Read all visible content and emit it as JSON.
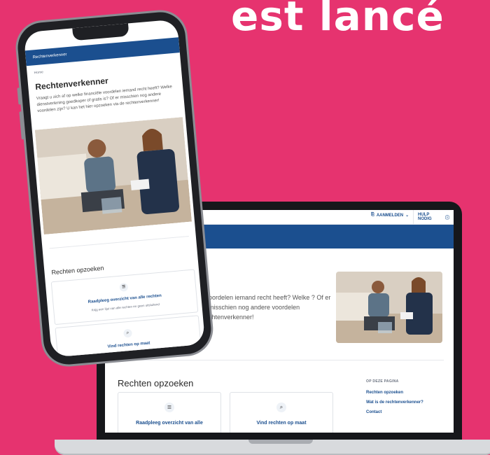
{
  "headline": "est lancé",
  "laptop": {
    "login_label": "AANMELDEN",
    "help_label": "HULP NODIG",
    "title": "r",
    "intro": "oordelen iemand recht heeft? Welke ? Of er misschien nog andere voordelen chtenverkenner!",
    "section_title": "Rechten opzoeken",
    "cards": [
      {
        "icon": "list-icon",
        "label": "Raadpleeg overzicht van alle"
      },
      {
        "icon": "search-icon",
        "label": "Vind rechten op maat"
      }
    ],
    "sidebar": {
      "title": "OP DEZE PAGINA",
      "links": [
        "Rechten opzoeken",
        "Wat is de rechtenverkenner?",
        "Contact"
      ]
    }
  },
  "phone": {
    "nav_title": "Rechtenverkenner",
    "breadcrumb": "Home",
    "title": "Rechtenverkenner",
    "intro": "Vraagt u zich af op welke financiële voordelen iemand recht heeft? Welke dienstverlening goedkoper of gratis is? Of er misschien nog andere voordelen zijn? U kan het hier opzoeken via de rechtenverkenner!",
    "section_title": "Rechten opzoeken",
    "cards": [
      {
        "icon": "list-icon",
        "label": "Raadpleeg overzicht van alle rechten",
        "desc": "Krijg een lijst van alle rechten en geen uitsluitend"
      },
      {
        "icon": "search-icon",
        "label": "Vind rechten op maat",
        "desc": ""
      }
    ]
  },
  "colors": {
    "background": "#e6336f",
    "brand_blue": "#1b4f8f"
  }
}
